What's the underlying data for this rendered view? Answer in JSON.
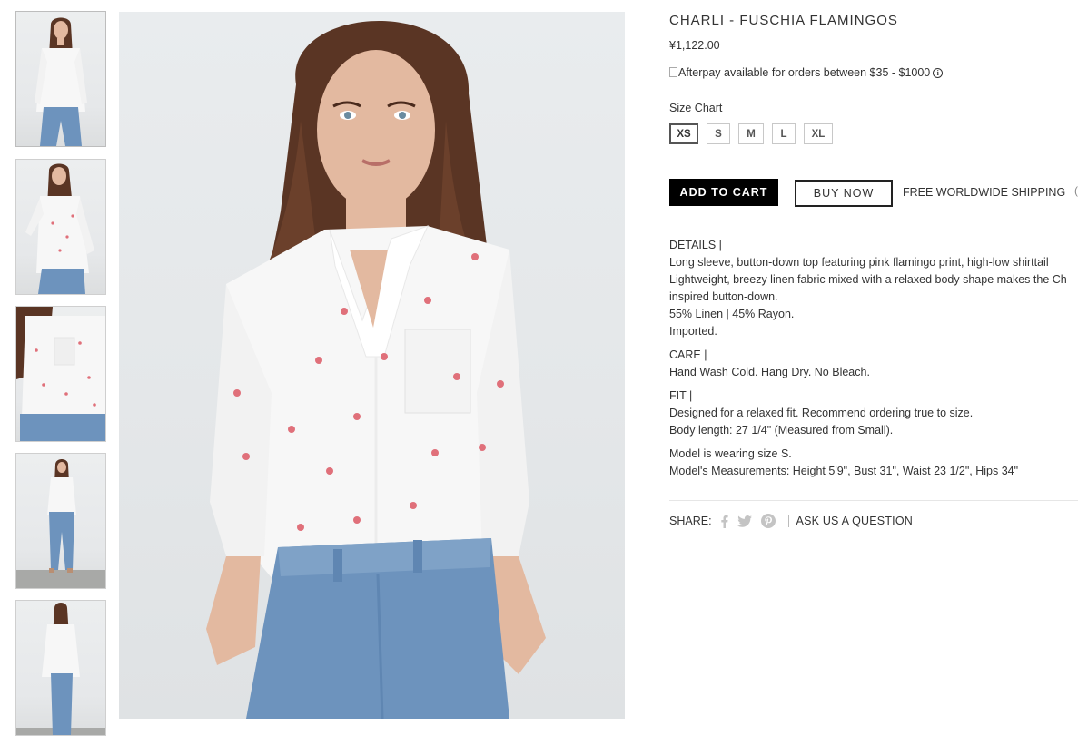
{
  "product": {
    "title": "CHARLI - FUSCHIA FLAMINGOS",
    "price": "¥1,122.00",
    "afterpay_text": "Afterpay available for orders between $35 - $1000",
    "afterpay_info_glyph": "i",
    "size_chart_label": "Size Chart",
    "sizes": [
      "XS",
      "S",
      "M",
      "L",
      "XL"
    ],
    "selected_size": "XS"
  },
  "actions": {
    "add_to_cart_label": "ADD TO CART",
    "buy_now_label": "BUY NOW",
    "shipping_label": "FREE WORLDWIDE SHIPPING",
    "shipping_overflow_glyph": "("
  },
  "description": {
    "details_heading": "DETAILS |",
    "details_lines": [
      "Long sleeve, button-down top featuring pink flamingo print, high-low shirttail",
      "Lightweight, breezy linen fabric mixed with a relaxed body shape makes the Ch",
      "inspired button-down.",
      "55% Linen | 45% Rayon.",
      "Imported."
    ],
    "care_heading": "CARE |",
    "care_lines": [
      "Hand Wash Cold. Hang Dry. No Bleach."
    ],
    "fit_heading": "FIT |",
    "fit_lines": [
      "Designed for a relaxed fit. Recommend ordering true to size.",
      "Body length: 27 1/4\" (Measured from Small)."
    ],
    "model_lines": [
      "Model is wearing size S.",
      "Model's Measurements: Height 5'9\", Bust 31\", Waist 23 1/2\", Hips 34\""
    ]
  },
  "share": {
    "label": "SHARE:",
    "icons": [
      "facebook-icon",
      "twitter-icon",
      "pinterest-icon"
    ],
    "ask_label": "ASK US A QUESTION"
  },
  "gallery": {
    "thumbnail_count": 5,
    "colors": {
      "shirt": "#f7f7f7",
      "denim": "#6d93bd",
      "hair": "#5a3524",
      "skin": "#e3b9a0",
      "flamingo": "#e0707a",
      "background": "#e6e8ea"
    }
  }
}
